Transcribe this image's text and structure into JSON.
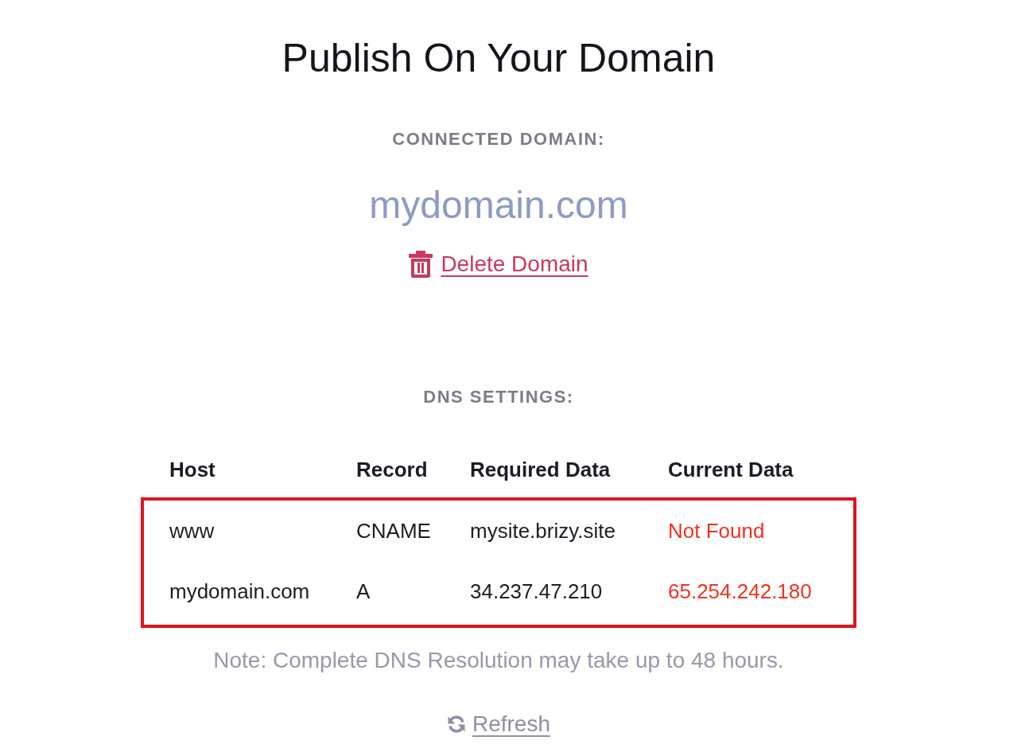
{
  "title": "Publish On Your Domain",
  "connected_domain": {
    "label": "CONNECTED DOMAIN:",
    "domain": "mydomain.com",
    "delete_link": "Delete Domain"
  },
  "dns_settings": {
    "label": "DNS SETTINGS:",
    "table": {
      "columns": [
        "Host",
        "Record",
        "Required Data",
        "Current Data"
      ],
      "highlighted": true,
      "rows": [
        {
          "host": "www",
          "record": "CNAME",
          "required_data": "mysite.brizy.site",
          "current_data": "Not Found",
          "matches": false
        },
        {
          "host": "mydomain.com",
          "record": "A",
          "required_data": "34.237.47.210",
          "current_data": "65.254.242.180",
          "matches": false
        }
      ]
    }
  },
  "note": "Note: Complete DNS Resolution may take up to 48 hours.",
  "refresh_link": "Refresh"
}
